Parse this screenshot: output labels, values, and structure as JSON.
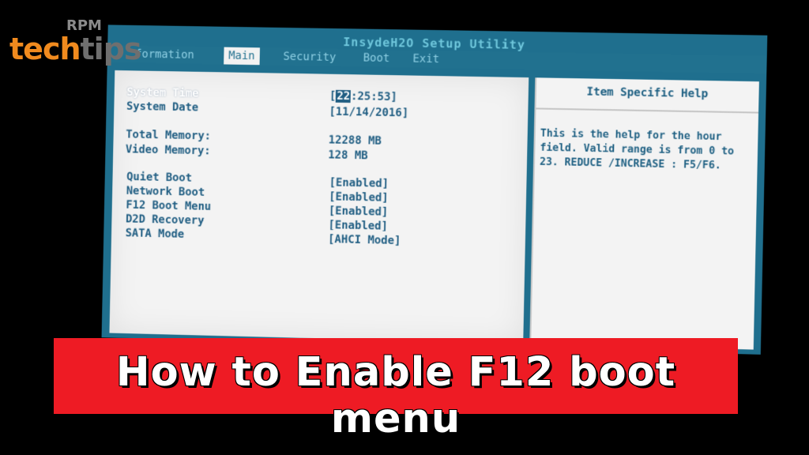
{
  "bios": {
    "title": "InsydeH2O Setup Utility",
    "menu": [
      {
        "label": "formation",
        "active": false
      },
      {
        "label": "Main",
        "active": true
      },
      {
        "label": "Security",
        "active": false
      },
      {
        "label": "Boot",
        "active": false
      },
      {
        "label": "Exit",
        "active": false
      }
    ],
    "settings": {
      "system_time": {
        "label": "System Time",
        "value_open": "[",
        "value_hour": "22",
        "value_rest": ":25:53]"
      },
      "system_date": {
        "label": "System Date",
        "value": "[11/14/2016]"
      },
      "total_memory": {
        "label": "Total Memory:",
        "value": "12288 MB"
      },
      "video_memory": {
        "label": "Video Memory:",
        "value": "128 MB"
      },
      "quiet_boot": {
        "label": "Quiet Boot",
        "value": "[Enabled]"
      },
      "network_boot": {
        "label": "Network Boot",
        "value": "[Enabled]"
      },
      "f12_boot_menu": {
        "label": "F12 Boot Menu",
        "value": "[Enabled]"
      },
      "d2d_recovery": {
        "label": "D2D Recovery",
        "value": "[Enabled]"
      },
      "sata_mode": {
        "label": "SATA Mode",
        "value": "[AHCI Mode]"
      }
    },
    "help": {
      "header": "Item Specific Help",
      "text": "This is the help for the hour field. Valid range is from 0 to 23. REDUCE /INCREASE : F5/F6."
    }
  },
  "banner": {
    "text": "How to Enable F12 boot menu",
    "color": "#ee1b24"
  },
  "logo": {
    "top": "RPM",
    "part_a": "tech",
    "part_b": "tips"
  }
}
